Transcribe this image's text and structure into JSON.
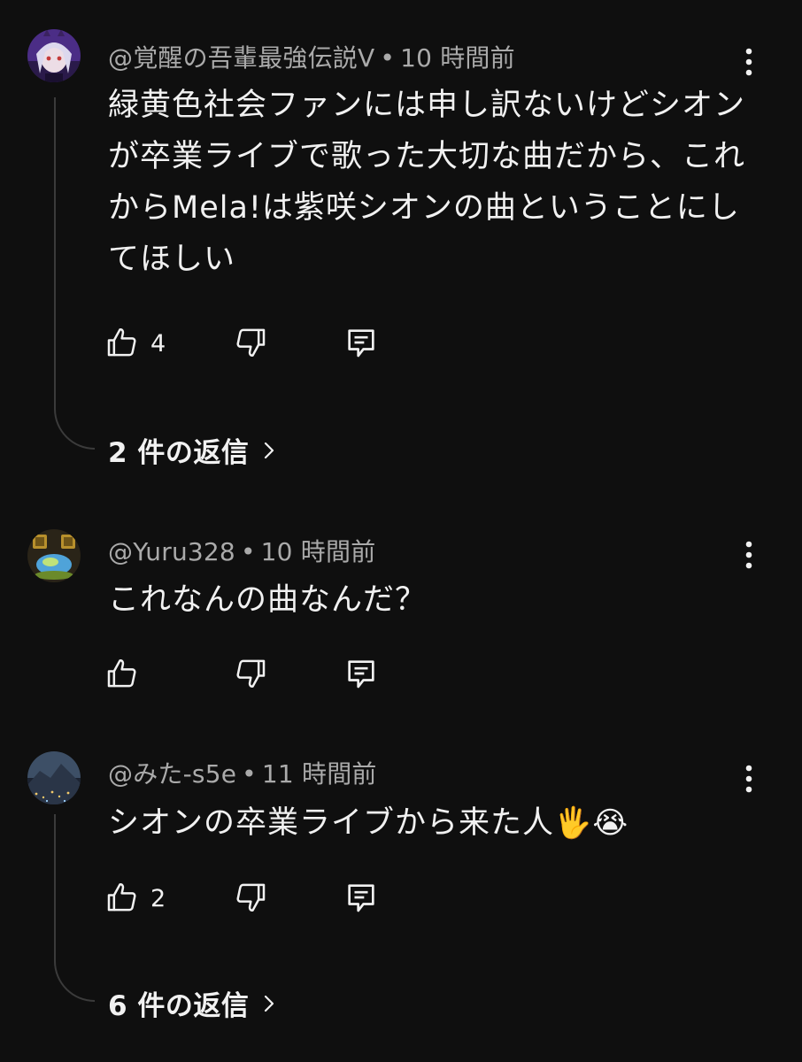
{
  "comments": [
    {
      "author": "@覚醒の吾輩最強伝説V",
      "time": "10 時間前",
      "text_lines": [
        "緑黄色社会ファンには申し訳ないけどシオン",
        "が卒業ライブで歌った大切な曲だから、これ",
        "からMela!は紫咲シオンの曲ということにし",
        "てほしい"
      ],
      "likes": "4",
      "replies_label": "2 件の返信"
    },
    {
      "author": "@Yuru328",
      "time": "10 時間前",
      "text_lines": [
        "これなんの曲なんだ？"
      ],
      "likes": ""
    },
    {
      "author": "@みた-s5e",
      "time": "11 時間前",
      "text_lines": [
        "シオンの卒業ライブから来た人"
      ],
      "emojis": [
        "🖐",
        "😭"
      ],
      "likes": "2",
      "replies_label": "6 件の返信"
    }
  ],
  "icons": {
    "like": "thumbs-up-icon",
    "dislike": "thumbs-down-icon",
    "reply": "comment-reply-icon",
    "menu": "more-vert-icon",
    "chevron": "chevron-right-icon"
  },
  "colors": {
    "background": "#0f0f0f",
    "primary_text": "#f1f1f1",
    "secondary_text": "#aaaaaa",
    "thread_line": "#3b3b3b"
  }
}
